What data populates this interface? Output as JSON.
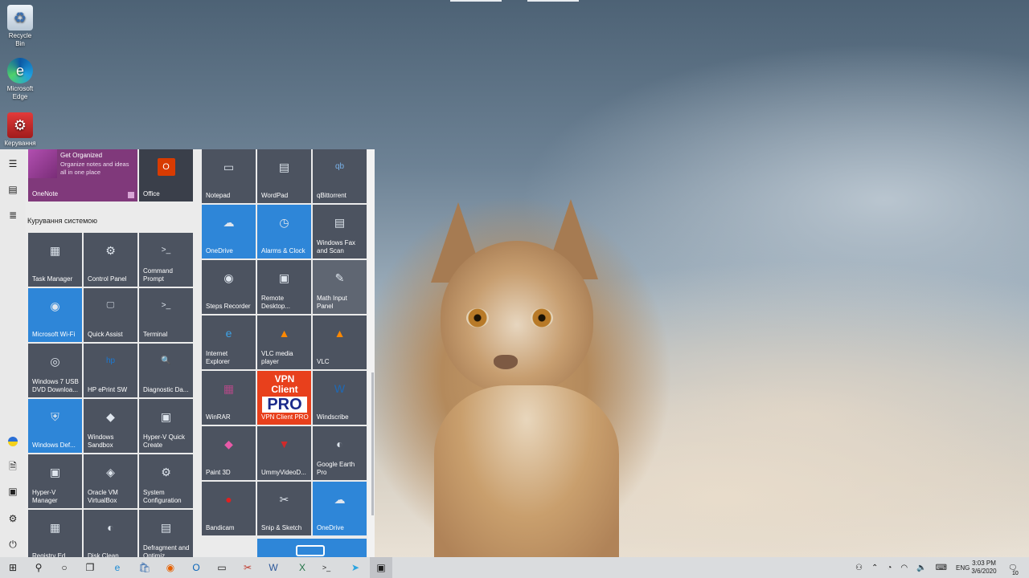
{
  "desktop": {
    "icons": [
      {
        "label": "Recycle Bin",
        "icon": "recycle-bin-icon"
      },
      {
        "label": "Microsoft Edge",
        "icon": "edge-icon"
      },
      {
        "label": "Керування",
        "icon": "control-panel-icon"
      }
    ]
  },
  "start_menu": {
    "rail": {
      "items": [
        "menu-icon",
        "tiles-icon",
        "all-apps-icon",
        "ukraine-flag-icon",
        "documents-icon",
        "pictures-icon",
        "settings-icon",
        "power-icon"
      ]
    },
    "group_label": "Курування системою",
    "tiles_left_top": [
      {
        "label": "OneNote",
        "title": "Get Organized",
        "subtitle": "Organize notes and ideas all in one place",
        "icon": "onenote-icon",
        "color": "#80397b"
      },
      {
        "label": "Office",
        "icon": "office-icon",
        "color": "#3a3f4a"
      }
    ],
    "tiles_left": [
      {
        "label": "Task Manager",
        "icon": "task-manager-icon"
      },
      {
        "label": "Control Panel",
        "icon": "control-panel-icon"
      },
      {
        "label": "Command Prompt",
        "icon": "command-prompt-icon"
      },
      {
        "label": "Microsoft Wi-Fi",
        "icon": "wifi-icon",
        "color": "#2e86d8"
      },
      {
        "label": "Quick Assist",
        "icon": "quick-assist-icon"
      },
      {
        "label": "Terminal",
        "icon": "terminal-icon"
      },
      {
        "label": "Windows 7 USB DVD Downloa...",
        "icon": "usb-dvd-icon"
      },
      {
        "label": "HP ePrint SW",
        "icon": "hp-icon"
      },
      {
        "label": "Diagnostic Da...",
        "icon": "diagnostic-icon"
      },
      {
        "label": "Windows Def...",
        "icon": "shield-icon",
        "color": "#2e86d8"
      },
      {
        "label": "Windows Sandbox",
        "icon": "sandbox-icon"
      },
      {
        "label": "Hyper-V Quick Create",
        "icon": "hyperv-quick-icon"
      },
      {
        "label": "Hyper-V Manager",
        "icon": "hyperv-manager-icon"
      },
      {
        "label": "Oracle VM VirtualBox",
        "icon": "virtualbox-icon"
      },
      {
        "label": "System Configuration",
        "icon": "system-config-icon"
      },
      {
        "label": "Registry Ed...",
        "icon": "registry-icon"
      },
      {
        "label": "Disk Clean...",
        "icon": "disk-cleanup-icon"
      },
      {
        "label": "Defragment and Optimiz...",
        "icon": "defragment-icon"
      }
    ],
    "tiles_right": [
      {
        "label": "Notepad",
        "icon": "notepad-icon"
      },
      {
        "label": "WordPad",
        "icon": "wordpad-icon"
      },
      {
        "label": "qBittorrent",
        "icon": "qbittorrent-icon"
      },
      {
        "label": "OneDrive",
        "icon": "onedrive-icon",
        "color": "#2e86d8"
      },
      {
        "label": "Alarms & Clock",
        "icon": "alarm-clock-icon",
        "color": "#2e86d8"
      },
      {
        "label": "Windows Fax and Scan",
        "icon": "fax-icon"
      },
      {
        "label": "Steps Recorder",
        "icon": "steps-recorder-icon"
      },
      {
        "label": "Remote Desktop...",
        "icon": "remote-desktop-icon"
      },
      {
        "label": "Math Input Panel",
        "icon": "math-input-icon",
        "color": "#5f6672"
      },
      {
        "label": "Internet Explorer",
        "icon": "internet-explorer-icon"
      },
      {
        "label": "VLC media player",
        "icon": "vlc-icon"
      },
      {
        "label": "VLC",
        "icon": "vlc-icon"
      },
      {
        "label": "WinRAR",
        "icon": "winrar-icon"
      },
      {
        "label": "VPN Client PRO",
        "icon": "vpn-client-icon",
        "color": "#e8401c",
        "badge_text": [
          "VPN",
          "Client",
          "PRO"
        ]
      },
      {
        "label": "Windscribe",
        "icon": "windscribe-icon"
      },
      {
        "label": "Paint 3D",
        "icon": "paint3d-icon"
      },
      {
        "label": "UmmyVideoD...",
        "icon": "ummy-icon"
      },
      {
        "label": "Google Earth Pro",
        "icon": "google-earth-icon"
      },
      {
        "label": "Bandicam",
        "icon": "bandicam-icon"
      },
      {
        "label": "Snip & Sketch",
        "icon": "snip-sketch-icon"
      },
      {
        "label": "OneDrive",
        "icon": "onedrive-icon",
        "color": "#2e86d8"
      }
    ]
  },
  "taskbar": {
    "items": [
      "start-icon",
      "search-icon",
      "cortana-icon",
      "task-view-icon",
      "edge-icon",
      "store-icon",
      "firefox-icon",
      "outlook-icon",
      "notepad-icon",
      "snipping-icon",
      "word-icon",
      "excel-icon",
      "terminal-icon",
      "telegram-icon",
      "tablet-icon"
    ],
    "tray": {
      "language": "ENG",
      "time": "3:03 PM",
      "date": "3/6/2020",
      "notification_count": "10"
    }
  }
}
